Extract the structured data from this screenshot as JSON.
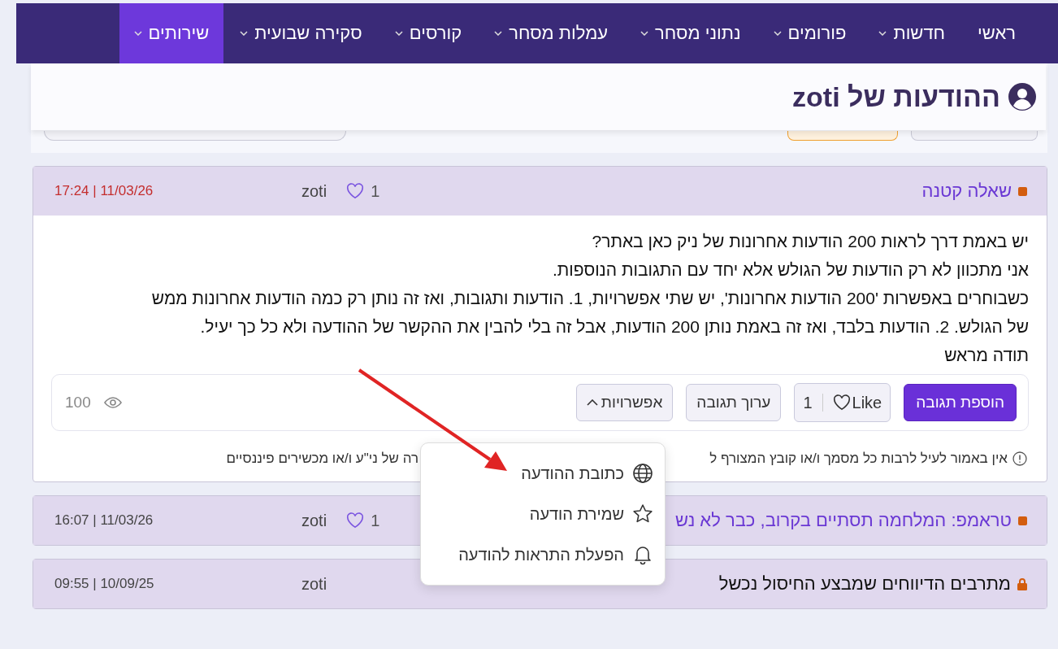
{
  "nav": [
    {
      "label": "ראשי",
      "has_menu": false,
      "selected": false
    },
    {
      "label": "חדשות",
      "has_menu": true,
      "selected": false
    },
    {
      "label": "פורומים",
      "has_menu": true,
      "selected": false
    },
    {
      "label": "נתוני מסחר",
      "has_menu": true,
      "selected": false
    },
    {
      "label": "עמלות מסחר",
      "has_menu": true,
      "selected": false
    },
    {
      "label": "קורסים",
      "has_menu": true,
      "selected": false
    },
    {
      "label": "סקירה שבועית",
      "has_menu": true,
      "selected": false
    },
    {
      "label": "שירותים",
      "has_menu": true,
      "selected": true
    }
  ],
  "page_title": "ההודעות של zoti",
  "threads": [
    {
      "title": "שאלה קטנה",
      "locked": false,
      "likes": "1",
      "author": "zoti",
      "datetime": "17:24 | 11/03/26",
      "date_highlight": true,
      "expanded": true,
      "body": [
        "יש באמת דרך לראות 200 הודעות אחרונות של ניק כאן באתר?",
        "אני מתכוון לא רק הודעות של הגולש אלא יחד עם התגובות הנוספות.",
        "כשבוחרים באפשרות '200 הודעות אחרונות', יש שתי אפשרויות, 1. הודעות ותגובות, ואז זה נותן רק כמה הודעות אחרונות ממש",
        "של הגולש. 2. הודעות בלבד, ואז זה באמת נותן 200 הודעות, אבל זה בלי להבין את ההקשר של ההודעה ולא כל כך יעיל.",
        "תודה מראש"
      ],
      "actions": {
        "reply": "הוספת תגובה",
        "like": "Like",
        "like_count": "1",
        "edit": "ערוך תגובה",
        "options": "אפשרויות",
        "options_expanded": true,
        "views": "100"
      },
      "disclaimer_start": "אין באמור לעיל לרבות כל מסמך ו/או קובץ המצורף ל",
      "disclaimer_end": "רה של ני\"ע ו/או מכשירים פיננסיים",
      "menu": [
        {
          "kind": "globe",
          "label": "כתובת ההודעה"
        },
        {
          "kind": "star",
          "label": "שמירת הודעה"
        },
        {
          "kind": "bell",
          "label": "הפעלת התראות להודעה"
        }
      ]
    },
    {
      "title": "טראמפ: המלחמה תסתיים בקרוב, כבר לא נש",
      "locked": false,
      "likes": "1",
      "author": "zoti",
      "datetime": "16:07 | 11/03/26",
      "date_highlight": false,
      "expanded": false
    },
    {
      "title": "מתרבים הדיווחים שמבצע החיסול נכשל",
      "locked": true,
      "author": "zoti",
      "datetime": "09:55 | 10/09/25",
      "date_highlight": false,
      "expanded": false
    }
  ]
}
